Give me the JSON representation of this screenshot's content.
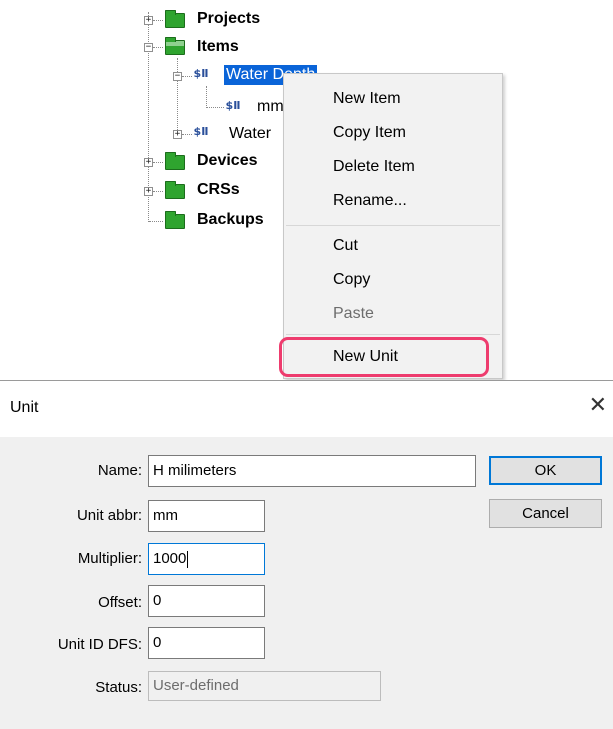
{
  "tree": {
    "projects": "Projects",
    "items": "Items",
    "water_depth": "Water Depth",
    "mm_child": "mm",
    "water_2": "Water",
    "devices": "Devices",
    "crss": "CRSs",
    "backups": "Backups"
  },
  "context_menu": {
    "new_item": "New Item",
    "copy_item": "Copy Item",
    "delete_item": "Delete Item",
    "rename": "Rename...",
    "cut": "Cut",
    "copy": "Copy",
    "paste": "Paste",
    "new_unit": "New Unit",
    "highlight_color": "#ee3c6e"
  },
  "dialog": {
    "title": "Unit",
    "close_glyph": "✕",
    "fields": {
      "name_label": "Name:",
      "name_value": "H milimeters",
      "abbr_label": "Unit abbr:",
      "abbr_value": "mm",
      "multiplier_label": "Multiplier:",
      "multiplier_value": "1000",
      "offset_label": "Offset:",
      "offset_value": "0",
      "dfs_label": "Unit ID DFS:",
      "dfs_value": "0",
      "status_label": "Status:",
      "status_value": "User-defined"
    },
    "ok_label": "OK",
    "cancel_label": "Cancel"
  },
  "colors": {
    "selection": "#0a64d8",
    "folder": "#2fa42f",
    "focus": "#0078d7"
  }
}
